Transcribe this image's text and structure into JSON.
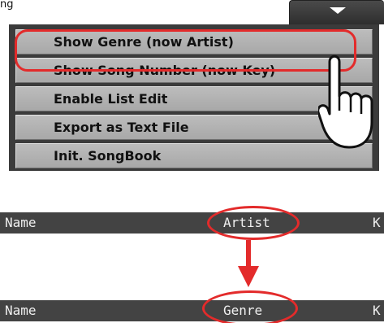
{
  "top_label": "ng",
  "menu": {
    "items": [
      "Show Genre (now Artist)",
      "Show Song Number (now Key)",
      "Enable List Edit",
      "Export as Text File",
      "Init. SongBook"
    ]
  },
  "header_before": {
    "name": "Name",
    "column": "Artist",
    "next": "K"
  },
  "header_after": {
    "name": "Name",
    "column": "Genre",
    "next": "K"
  },
  "colors": {
    "highlight": "#e32b2b",
    "menu_bg": "#3b3b3b",
    "header_bg": "#434343"
  },
  "icons": [
    "chevron-down-icon",
    "pointing-hand-icon",
    "arrow-down-icon"
  ]
}
